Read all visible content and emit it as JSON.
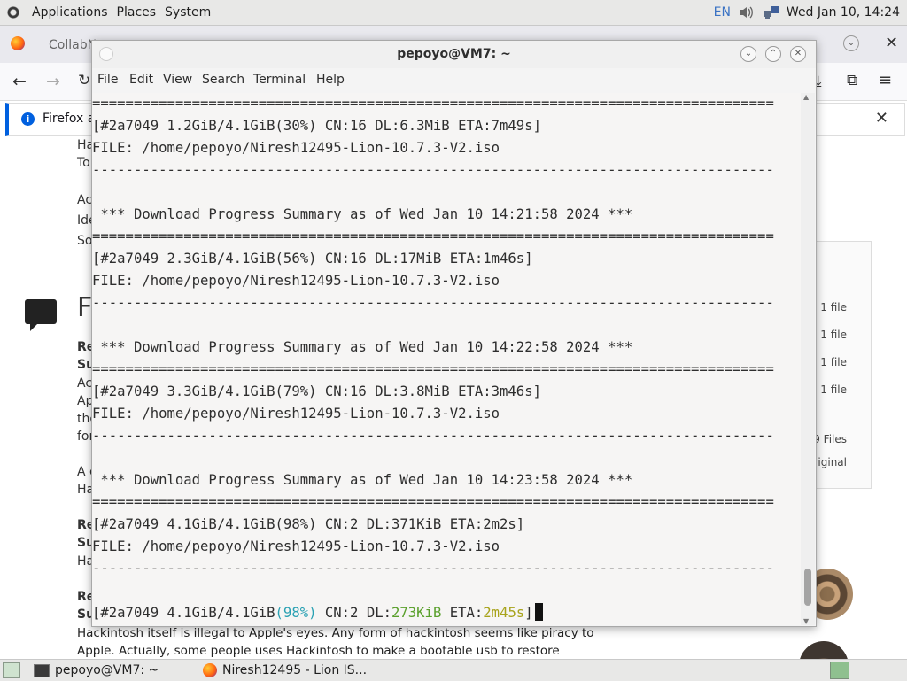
{
  "top_panel": {
    "menus": [
      "Applications",
      "Places",
      "System"
    ],
    "lang": "EN",
    "clock": "Wed Jan 10, 14:24"
  },
  "firefox": {
    "tab1_label": "CollabN",
    "notification_text": "Firefox au",
    "left_fragments": [
      "Ha",
      "To",
      "Ac",
      "Ide",
      "So",
      "F",
      "Re",
      "Su",
      "Ac",
      "Ap",
      "the",
      "for",
      "A c",
      "Ha",
      "Re",
      "Su",
      "Ha",
      "Re",
      "Su"
    ],
    "bottom_text_1": "Hackintosh itself is illegal to Apple's eyes. Any form of hackintosh seems like piracy to",
    "bottom_text_2": "Apple. Actually, some people uses Hackintosh to make a bootable usb to restore",
    "right_files": [
      "1 file",
      "1 file",
      "1 file",
      "1 file"
    ],
    "right_total": "9 Files",
    "right_original": "Original"
  },
  "terminal": {
    "title": "pepoyo@VM7: ~",
    "menus": [
      "File",
      "Edit",
      "View",
      "Search",
      "Terminal",
      "Help"
    ],
    "lines": [
      "==================================================================================",
      "[#2a7049 1.2GiB/4.1GiB(30%) CN:16 DL:6.3MiB ETA:7m49s]",
      "FILE: /home/pepoyo/Niresh12495-Lion-10.7.3-V2.iso",
      "----------------------------------------------------------------------------------",
      "",
      " *** Download Progress Summary as of Wed Jan 10 14:21:58 2024 ***",
      "==================================================================================",
      "[#2a7049 2.3GiB/4.1GiB(56%) CN:16 DL:17MiB ETA:1m46s]",
      "FILE: /home/pepoyo/Niresh12495-Lion-10.7.3-V2.iso",
      "----------------------------------------------------------------------------------",
      "",
      " *** Download Progress Summary as of Wed Jan 10 14:22:58 2024 ***",
      "==================================================================================",
      "[#2a7049 3.3GiB/4.1GiB(79%) CN:16 DL:3.8MiB ETA:3m46s]",
      "FILE: /home/pepoyo/Niresh12495-Lion-10.7.3-V2.iso",
      "----------------------------------------------------------------------------------",
      "",
      " *** Download Progress Summary as of Wed Jan 10 14:23:58 2024 ***",
      "==================================================================================",
      "[#2a7049 4.1GiB/4.1GiB(98%) CN:2 DL:371KiB ETA:2m2s]",
      "FILE: /home/pepoyo/Niresh12495-Lion-10.7.3-V2.iso",
      "----------------------------------------------------------------------------------",
      ""
    ],
    "live_line": {
      "part1": "[#2a7049 4.1GiB/4.1GiB",
      "pct": "(98%)",
      "part2": " CN:2 DL:",
      "dl": "273KiB",
      "part3": " ETA:",
      "eta": "2m45s",
      "part4": "]"
    }
  },
  "taskbar": {
    "items": [
      "pepoyo@VM7: ~",
      "Niresh12495 - Lion IS..."
    ]
  }
}
